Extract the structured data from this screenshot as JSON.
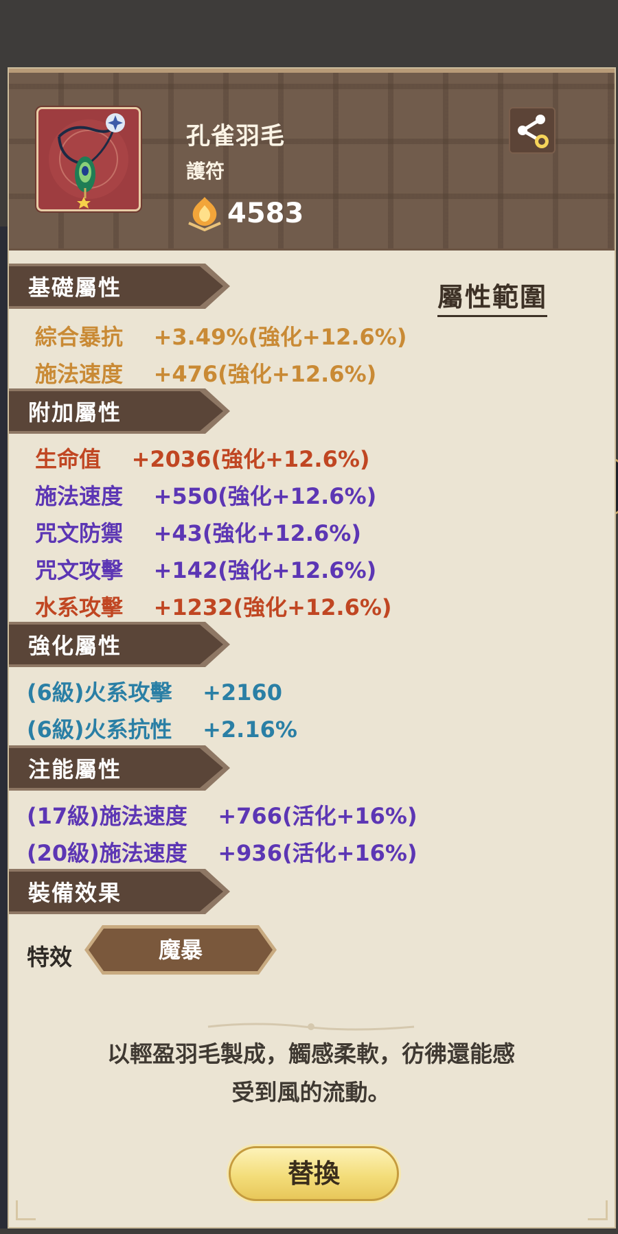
{
  "item": {
    "name": "孔雀羽毛",
    "type": "護符",
    "power": "4583",
    "icon": "peacock-feather-icon",
    "rarity": "star-icon"
  },
  "header": {
    "share_icon": "share-icon"
  },
  "attr_range_label": "屬性範圍",
  "sections": {
    "basic": {
      "title": "基礎屬性",
      "rows": [
        {
          "text": "綜合暴抗    +3.49%(強化+12.6%)",
          "color": "#c98a35"
        },
        {
          "text": "施法速度    +476(強化+12.6%)",
          "color": "#c98a35"
        }
      ]
    },
    "additional": {
      "title": "附加屬性",
      "rows": [
        {
          "text": "生命值    +2036(強化+12.6%)",
          "color": "#c04622"
        },
        {
          "text": "施法速度    +550(強化+12.6%)",
          "color": "#5c36b4"
        },
        {
          "text": "咒文防禦    +43(強化+12.6%)",
          "color": "#5c36b4"
        },
        {
          "text": "咒文攻擊    +142(強化+12.6%)",
          "color": "#5c36b4"
        },
        {
          "text": "水系攻擊    +1232(強化+12.6%)",
          "color": "#c04622"
        }
      ]
    },
    "enhance": {
      "title": "強化屬性",
      "rows": [
        {
          "text": "(6級)火系攻擊    +2160",
          "color": "#2a7fa5"
        },
        {
          "text": "(6級)火系抗性    +2.16%",
          "color": "#2a7fa5"
        }
      ]
    },
    "infuse": {
      "title": "注能屬性",
      "rows": [
        {
          "text": "(17級)施法速度    +766(活化+16%)",
          "color": "#5c36b4"
        },
        {
          "text": "(20級)施法速度    +936(活化+16%)",
          "color": "#5c36b4"
        }
      ]
    },
    "equip": {
      "title": "裝備效果"
    }
  },
  "effect": {
    "label": "特效",
    "value": "魔暴"
  },
  "description_lines": [
    "以輕盈羽毛製成，觸感柔軟，彷彿還能感",
    "受到風的流動。"
  ],
  "button": {
    "replace": "替換"
  }
}
